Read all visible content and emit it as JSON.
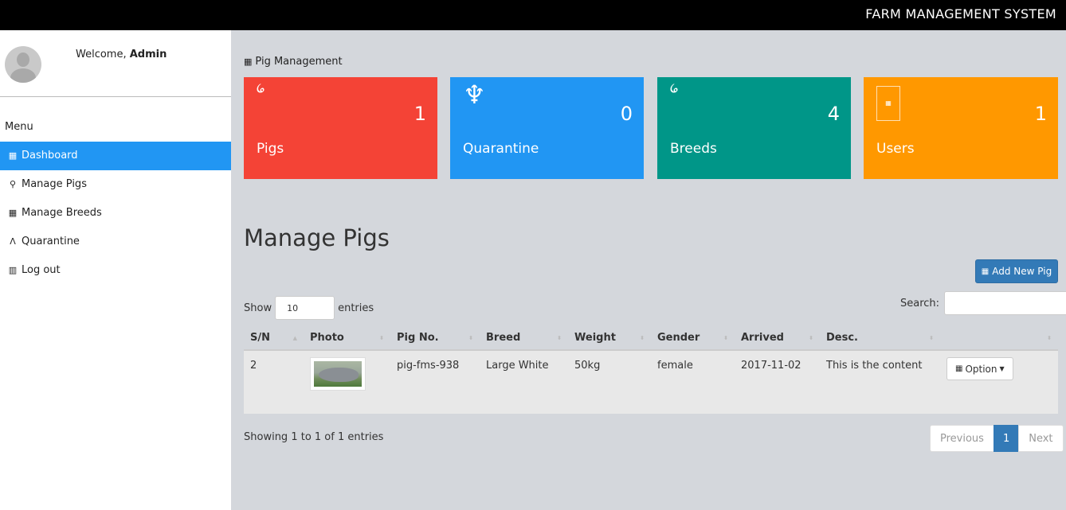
{
  "header": {
    "brand": "FARM MANAGEMENT SYSTEM"
  },
  "sidebar": {
    "welcome_prefix": "Welcome,",
    "username": "Admin",
    "menu_title": "Menu",
    "items": [
      {
        "label": "Dashboard",
        "icon": "dashboard-icon",
        "active": true
      },
      {
        "label": "Manage Pigs",
        "icon": "pig-icon"
      },
      {
        "label": "Manage Breeds",
        "icon": "breeds-icon"
      },
      {
        "label": "Quarantine",
        "icon": "quarantine-icon"
      },
      {
        "label": "Log out",
        "icon": "logout-icon"
      }
    ]
  },
  "breadcrumb": "Pig Management",
  "stats": [
    {
      "label": "Pigs",
      "count": "1",
      "color": "#f44336",
      "icon": "pig-icon"
    },
    {
      "label": "Quarantine",
      "count": "0",
      "color": "#2196f3",
      "icon": "quarantine-icon"
    },
    {
      "label": "Breeds",
      "count": "4",
      "color": "#009688",
      "icon": "breeds-icon"
    },
    {
      "label": "Users",
      "count": "1",
      "color": "#ff9800",
      "icon": "users-icon"
    }
  ],
  "page_title": "Manage Pigs",
  "add_button": "Add New Pig",
  "show": {
    "prefix": "Show",
    "value": "10",
    "suffix": "entries"
  },
  "search": {
    "label": "Search:"
  },
  "table": {
    "columns": [
      "S/N",
      "Photo",
      "Pig No.",
      "Breed",
      "Weight",
      "Gender",
      "Arrived",
      "Desc.",
      ""
    ],
    "rows": [
      {
        "sn": "2",
        "pig_no": "pig-fms-938",
        "breed": "Large White",
        "weight": "50kg",
        "gender": "female",
        "arrived": "2017-11-02",
        "desc": "This is the content",
        "option": "Option"
      }
    ]
  },
  "info": "Showing 1 to 1 of 1 entries",
  "pager": {
    "prev": "Previous",
    "current": "1",
    "next": "Next"
  }
}
